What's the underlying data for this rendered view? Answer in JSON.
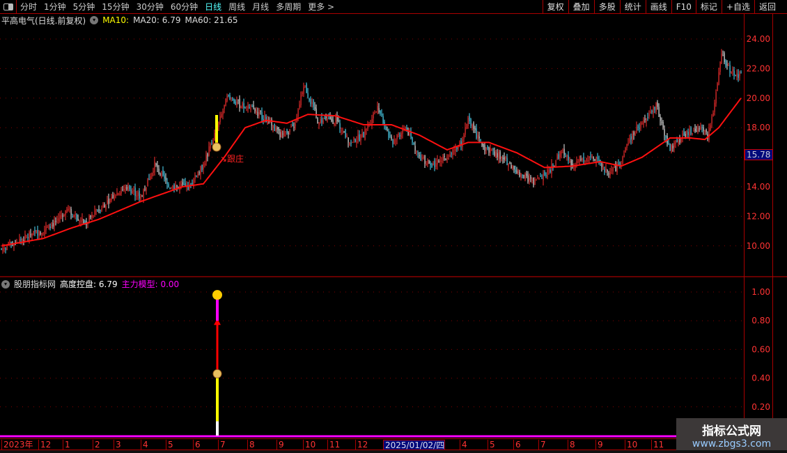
{
  "toolbar": {
    "periods": [
      "分时",
      "1分钟",
      "5分钟",
      "15分钟",
      "30分钟",
      "60分钟",
      "日线",
      "周线",
      "月线",
      "多周期",
      "更多 >"
    ],
    "active": "日线",
    "buttons": [
      "复权",
      "叠加",
      "多股",
      "统计",
      "画线",
      "F10",
      "标记",
      "+自选",
      "返回"
    ]
  },
  "header": {
    "title": "平高电气(日线.前复权)",
    "ma10": "MA10:",
    "ma20": "MA20: 6.79",
    "ma60": "MA60: 21.65"
  },
  "main": {
    "annotation": "跟庄",
    "current_price": "15.78",
    "price_ticks": [
      "24.00",
      "22.00",
      "20.00",
      "18.00",
      "14.00",
      "12.00",
      "10.00"
    ]
  },
  "indicator": {
    "name": "股朋指标网",
    "line1": "高度控盘: 6.79",
    "line2_label": "主力模型:",
    "line2_value": "0.00",
    "ticks": [
      "1.00",
      "0.80",
      "0.60",
      "0.40",
      "0.20"
    ],
    "signal": {
      "bar": "2024/07",
      "levels": {
        "white_top": 0.1,
        "yellow_top": 0.45,
        "red_top": 0.8,
        "magenta_top": 0.97
      }
    }
  },
  "time_axis": {
    "labels": [
      "2023年",
      "12",
      "1",
      "2",
      "3",
      "4",
      "5",
      "6",
      "7",
      "8",
      "9",
      "10",
      "11",
      "12",
      "2025/01/02/四",
      "4",
      "5",
      "6",
      "7",
      "8",
      "9",
      "10",
      "11"
    ],
    "selected": "2025/01/02/四"
  },
  "watermark": {
    "title": "指标公式网",
    "url": "www.zbgs3.com"
  },
  "colors": {
    "up": "#ff3030",
    "down": "#50e0ff",
    "ma": "#ff1010",
    "accent": "#5ff",
    "grid": "#a00000"
  },
  "chart_data": {
    "type": "candlestick",
    "ylim": [
      8,
      25
    ],
    "close_keypoints": [
      [
        0,
        9.8
      ],
      [
        20,
        10.7
      ],
      [
        35,
        11.3
      ],
      [
        47,
        12.5
      ],
      [
        60,
        11.5
      ],
      [
        70,
        12.5
      ],
      [
        82,
        13.5
      ],
      [
        90,
        14
      ],
      [
        100,
        13.3
      ],
      [
        110,
        15.5
      ],
      [
        120,
        14
      ],
      [
        135,
        14
      ],
      [
        145,
        15.5
      ],
      [
        155,
        18
      ],
      [
        162,
        20
      ],
      [
        172,
        19.5
      ],
      [
        185,
        19
      ],
      [
        200,
        17.5
      ],
      [
        210,
        18
      ],
      [
        217,
        21
      ],
      [
        227,
        18.5
      ],
      [
        240,
        18.5
      ],
      [
        250,
        17
      ],
      [
        260,
        17.5
      ],
      [
        270,
        19.5
      ],
      [
        280,
        17
      ],
      [
        290,
        18
      ],
      [
        300,
        16
      ],
      [
        310,
        15.5
      ],
      [
        320,
        16
      ],
      [
        330,
        17
      ],
      [
        335,
        18.5
      ],
      [
        345,
        16.8
      ],
      [
        360,
        16
      ],
      [
        370,
        15
      ],
      [
        382,
        14.3
      ],
      [
        395,
        15.3
      ],
      [
        402,
        16.5
      ],
      [
        410,
        15.5
      ],
      [
        425,
        16
      ],
      [
        435,
        15
      ],
      [
        445,
        15.5
      ],
      [
        450,
        17
      ],
      [
        457,
        18
      ],
      [
        470,
        19.5
      ],
      [
        480,
        16.5
      ],
      [
        490,
        17.5
      ],
      [
        500,
        18
      ],
      [
        507,
        17.5
      ],
      [
        512,
        19.5
      ],
      [
        517,
        23
      ],
      [
        522,
        22
      ],
      [
        531,
        21.5
      ]
    ],
    "ma_keypoints": [
      [
        0,
        10
      ],
      [
        30,
        10.5
      ],
      [
        50,
        11.2
      ],
      [
        70,
        11.8
      ],
      [
        100,
        13
      ],
      [
        130,
        14
      ],
      [
        145,
        14.2
      ],
      [
        160,
        16
      ],
      [
        175,
        18
      ],
      [
        190,
        18.5
      ],
      [
        205,
        18.3
      ],
      [
        220,
        18.9
      ],
      [
        240,
        18.8
      ],
      [
        260,
        18.2
      ],
      [
        280,
        18.2
      ],
      [
        300,
        17.5
      ],
      [
        320,
        16.5
      ],
      [
        335,
        17
      ],
      [
        350,
        17
      ],
      [
        370,
        16.3
      ],
      [
        390,
        15.3
      ],
      [
        410,
        15.4
      ],
      [
        430,
        15.7
      ],
      [
        445,
        15.4
      ],
      [
        460,
        16
      ],
      [
        480,
        17.3
      ],
      [
        495,
        17.3
      ],
      [
        505,
        17.2
      ],
      [
        515,
        18
      ],
      [
        531,
        20
      ]
    ]
  }
}
